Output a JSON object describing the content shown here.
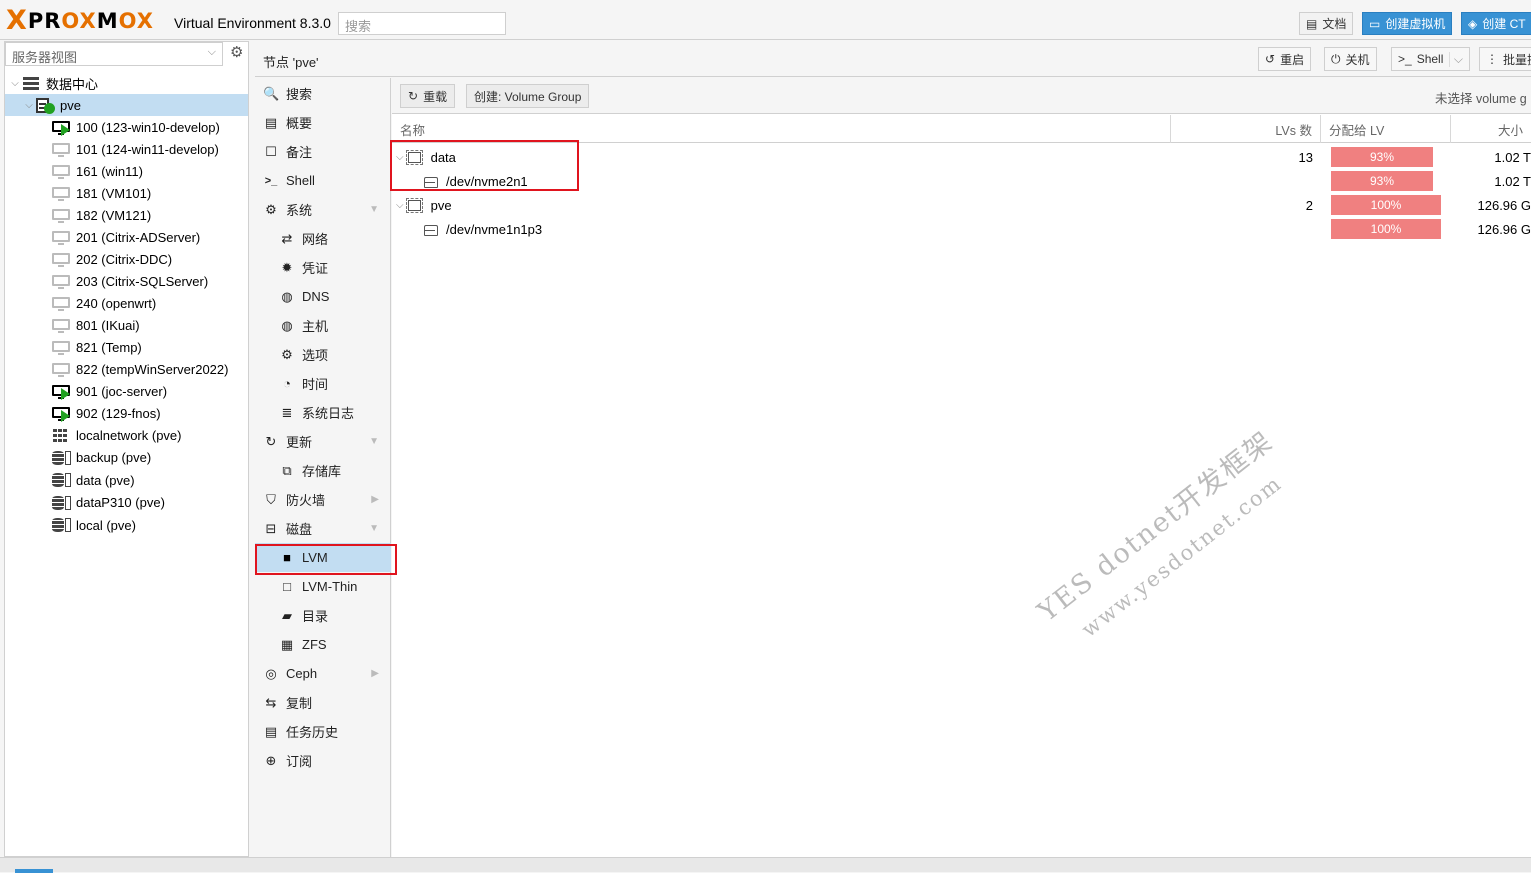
{
  "app": {
    "logo_text": "PROXMOX",
    "version": "Virtual Environment 8.3.0",
    "search_placeholder": "搜索",
    "docs_label": "文档",
    "create_vm_label": "创建虚拟机",
    "create_ct_label": "创建 CT"
  },
  "tree": {
    "view_select": "服务器视图",
    "items": [
      {
        "label": "数据中心",
        "kind": "datacenter"
      },
      {
        "label": "pve",
        "kind": "node"
      },
      {
        "label": "100 (123-win10-develop)",
        "kind": "vm-running"
      },
      {
        "label": "101 (124-win11-develop)",
        "kind": "vm"
      },
      {
        "label": "161 (win11)",
        "kind": "vm"
      },
      {
        "label": "181 (VM101)",
        "kind": "vm"
      },
      {
        "label": "182 (VM121)",
        "kind": "vm"
      },
      {
        "label": "201 (Citrix-ADServer)",
        "kind": "vm"
      },
      {
        "label": "202 (Citrix-DDC)",
        "kind": "vm"
      },
      {
        "label": "203 (Citrix-SQLServer)",
        "kind": "vm"
      },
      {
        "label": "240 (openwrt)",
        "kind": "vm"
      },
      {
        "label": "801 (IKuai)",
        "kind": "vm"
      },
      {
        "label": "821 (Temp)",
        "kind": "vm"
      },
      {
        "label": "822 (tempWinServer2022)",
        "kind": "vm"
      },
      {
        "label": "901 (joc-server)",
        "kind": "vm-running"
      },
      {
        "label": "902 (129-fnos)",
        "kind": "vm-running"
      },
      {
        "label": "localnetwork (pve)",
        "kind": "network"
      },
      {
        "label": "backup (pve)",
        "kind": "storage"
      },
      {
        "label": "data (pve)",
        "kind": "storage"
      },
      {
        "label": "dataP310 (pve)",
        "kind": "storage"
      },
      {
        "label": "local (pve)",
        "kind": "storage"
      }
    ]
  },
  "node_header": {
    "title": "节点 'pve'",
    "reboot_label": "重启",
    "shutdown_label": "关机",
    "shell_label": "Shell",
    "bulk_label": "批量操"
  },
  "nav": {
    "items": [
      {
        "label": "搜索",
        "icon": "search-icon",
        "glyph": "🔍"
      },
      {
        "label": "概要",
        "icon": "book-icon",
        "glyph": "▤"
      },
      {
        "label": "备注",
        "icon": "note-icon",
        "glyph": "☐"
      },
      {
        "label": "Shell",
        "icon": "terminal-icon",
        "glyph": ">_"
      },
      {
        "label": "系统",
        "icon": "cogs-icon",
        "glyph": "⚙"
      },
      {
        "label": "网络",
        "icon": "exchange-icon",
        "glyph": "⇄"
      },
      {
        "label": "凭证",
        "icon": "certificate-icon",
        "glyph": "✹"
      },
      {
        "label": "DNS",
        "icon": "globe-icon",
        "glyph": "◍"
      },
      {
        "label": "主机",
        "icon": "globe-icon",
        "glyph": "◍"
      },
      {
        "label": "选项",
        "icon": "gear-icon",
        "glyph": "⚙"
      },
      {
        "label": "时间",
        "icon": "clock-icon",
        "glyph": "◔"
      },
      {
        "label": "系统日志",
        "icon": "list-icon",
        "glyph": "≣"
      },
      {
        "label": "更新",
        "icon": "refresh-icon",
        "glyph": "↻"
      },
      {
        "label": "存储库",
        "icon": "files-icon",
        "glyph": "⧉"
      },
      {
        "label": "防火墙",
        "icon": "shield-icon",
        "glyph": "⛉"
      },
      {
        "label": "磁盘",
        "icon": "hdd-icon",
        "glyph": "⊟"
      },
      {
        "label": "LVM",
        "icon": "square-icon",
        "glyph": "■"
      },
      {
        "label": "LVM-Thin",
        "icon": "square-outline-icon",
        "glyph": "□"
      },
      {
        "label": "目录",
        "icon": "folder-icon",
        "glyph": "▰"
      },
      {
        "label": "ZFS",
        "icon": "th-large-icon",
        "glyph": "▦"
      },
      {
        "label": "Ceph",
        "icon": "ceph-icon",
        "glyph": "◎"
      },
      {
        "label": "复制",
        "icon": "retweet-icon",
        "glyph": "⇆"
      },
      {
        "label": "任务历史",
        "icon": "list-alt-icon",
        "glyph": "▤"
      },
      {
        "label": "订阅",
        "icon": "support-icon",
        "glyph": "⊕"
      }
    ]
  },
  "main": {
    "reload_label": "重载",
    "create_label": "创建: Volume Group",
    "no_selection": "未选择 volume g",
    "columns": [
      "名称",
      "LVs 数",
      "分配给 LV",
      "大小"
    ],
    "rows": [
      {
        "name": "data",
        "lvs": "13",
        "usage": "93%",
        "usage_pct": 93,
        "size": "1.02 T",
        "indent": 0
      },
      {
        "name": "/dev/nvme2n1",
        "lvs": "",
        "usage": "93%",
        "usage_pct": 93,
        "size": "1.02 T",
        "indent": 1
      },
      {
        "name": "pve",
        "lvs": "2",
        "usage": "100%",
        "usage_pct": 100,
        "size": "126.96 G",
        "indent": 0
      },
      {
        "name": "/dev/nvme1n1p3",
        "lvs": "",
        "usage": "100%",
        "usage_pct": 100,
        "size": "126.96 G",
        "indent": 1
      }
    ]
  },
  "watermark": {
    "line1": "YES dotnet开发框架",
    "line2": "www.yesdotnet.com"
  },
  "colors": {
    "accent": "#3892d4",
    "selected": "#c2ddf2",
    "usage_bar": "#f08080",
    "running": "#21a121",
    "logo_orange": "#e57000",
    "highlight": "#e0141e"
  }
}
